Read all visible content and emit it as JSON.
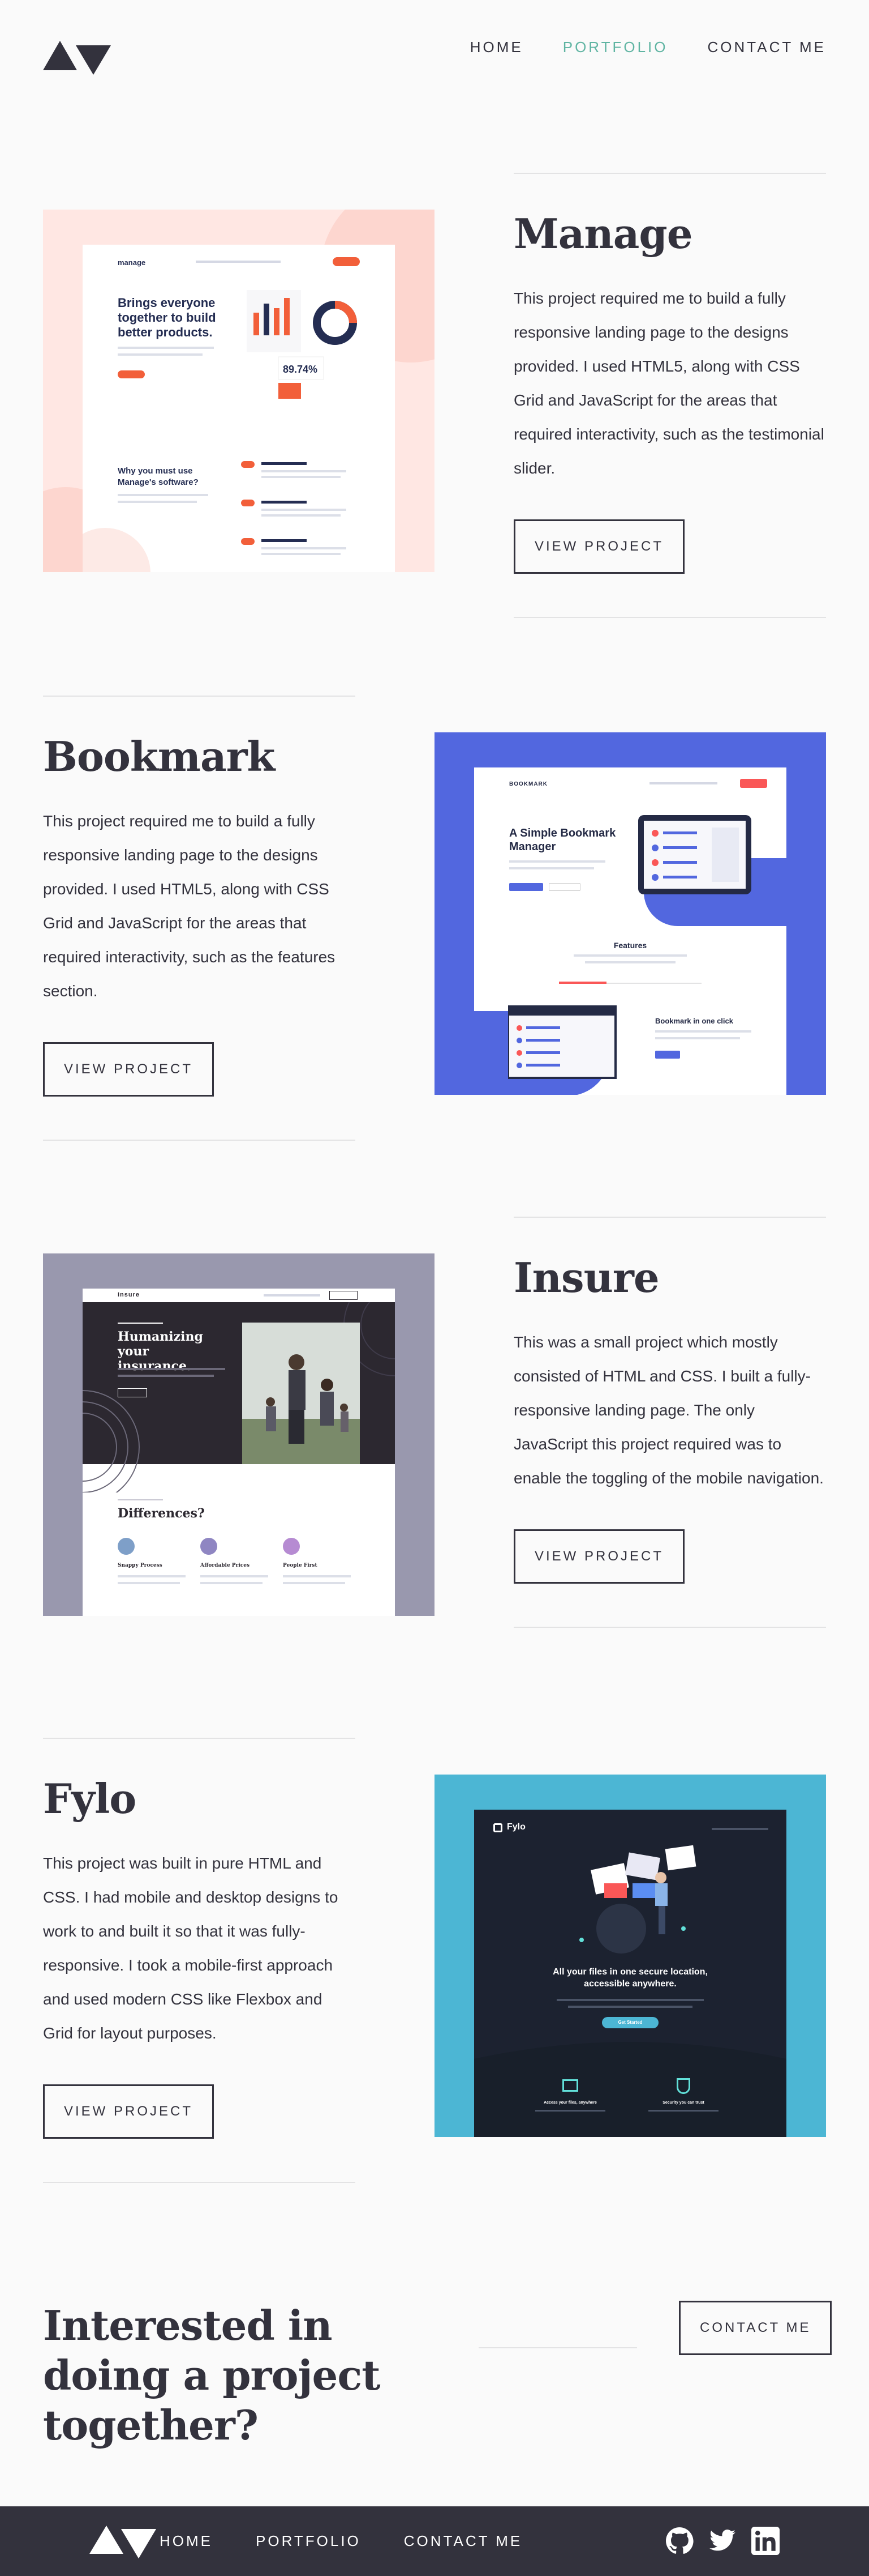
{
  "nav": {
    "home": "HOME",
    "portfolio": "PORTFOLIO",
    "contact": "CONTACT ME"
  },
  "projects": [
    {
      "title": "Manage",
      "description": "This project required me to build a fully responsive landing page to the designs provided. I used HTML5, along with CSS Grid and JavaScript for the areas that required interactivity, such as the testimonial slider.",
      "button": "VIEW PROJECT",
      "thumb": {
        "brand": "manage",
        "headline": "Brings everyone together to build better products.",
        "sub_headline": "Why you must use Manage's software?",
        "stat": "89.74%",
        "accent": "#f25f3a"
      }
    },
    {
      "title": "Bookmark",
      "description": "This project required me to build a fully responsive landing page to the designs provided. I used HTML5, along with CSS Grid and JavaScript for the areas that required interactivity, such as the features section.",
      "button": "VIEW PROJECT",
      "thumb": {
        "brand": "BOOKMARK",
        "headline": "A Simple Bookmark Manager",
        "features": "Features",
        "feature_title": "Bookmark in one click",
        "accent": "#5267df"
      }
    },
    {
      "title": "Insure",
      "description": "This was a small project which mostly consisted of HTML and CSS. I built a fully-responsive landing page. The only JavaScript this project required was to enable the toggling of the mobile navigation.",
      "button": "VIEW PROJECT",
      "thumb": {
        "brand": "insure",
        "headline": "Humanizing your insurance.",
        "sub_headline": "Differences?",
        "columns": [
          "Snappy Process",
          "Affordable Prices",
          "People First"
        ],
        "accent": "#2c2830"
      }
    },
    {
      "title": "Fylo",
      "description": "This project was built in pure HTML and CSS. I had mobile and desktop designs to work to and built it so that it was fully-responsive. I took a mobile-first approach and used modern CSS like Flexbox and Grid for layout purposes.",
      "button": "VIEW PROJECT",
      "thumb": {
        "brand": "Fylo",
        "headline": "All your files in one secure location, accessible anywhere.",
        "cta": "Get Started",
        "features": [
          "Access your files, anywhere",
          "Security you can trust"
        ],
        "accent": "#181f2a"
      }
    }
  ],
  "cta": {
    "title": "Interested in doing a project together?",
    "button": "CONTACT ME"
  },
  "footer": {
    "home": "HOME",
    "portfolio": "PORTFOLIO",
    "contact": "CONTACT ME",
    "socials": [
      "github-icon",
      "twitter-icon",
      "linkedin-icon"
    ]
  },
  "colors": {
    "dark": "#33323d",
    "accent": "#5fb4a2",
    "rule": "#e3e3e4",
    "background": "#fafafa"
  }
}
